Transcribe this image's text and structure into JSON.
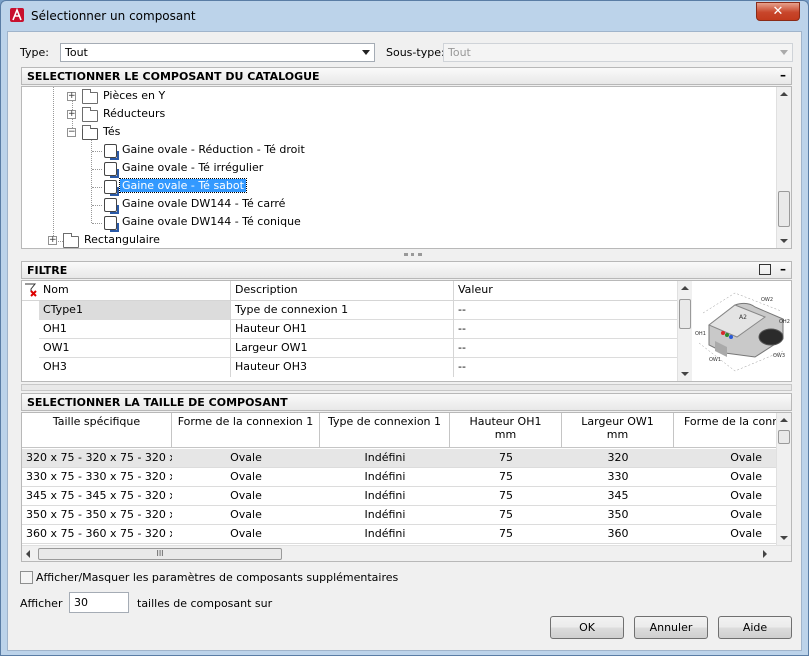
{
  "window": {
    "title": "Sélectionner un composant",
    "close": "✕"
  },
  "type_row": {
    "type_label": "Type:",
    "type_value": "Tout",
    "subtype_label": "Sous-type:",
    "subtype_value": "Tout"
  },
  "catalog": {
    "header": "SELECTIONNER LE COMPOSANT DU CATALOGUE",
    "collapse": "–",
    "items": [
      {
        "label": "Pièces en Y"
      },
      {
        "label": "Réducteurs"
      },
      {
        "label": "Tés"
      },
      {
        "label": "Gaine ovale - Réduction - Té droit"
      },
      {
        "label": "Gaine ovale - Té irrégulier"
      },
      {
        "label": "Gaine ovale - Té sabot"
      },
      {
        "label": "Gaine ovale DW144 - Té carré"
      },
      {
        "label": "Gaine ovale DW144 - Té conique"
      },
      {
        "label": "Rectangulaire"
      }
    ]
  },
  "filter": {
    "header": "FILTRE",
    "collapse": "–",
    "columns": [
      "Nom",
      "Description",
      "Valeur"
    ],
    "rows": [
      {
        "name": "CType1",
        "desc": "Type de connexion 1",
        "value": "--"
      },
      {
        "name": "OH1",
        "desc": "Hauteur OH1",
        "value": "--"
      },
      {
        "name": "OW1",
        "desc": "Largeur OW1",
        "value": "--"
      },
      {
        "name": "OH3",
        "desc": "Hauteur OH3",
        "value": "--"
      }
    ],
    "preview_labels": {
      "ow2": "OW2",
      "a2": "A2",
      "oh2": "OH2",
      "oh1": "OH1",
      "ow1": "OW1",
      "ow3": "OW3"
    }
  },
  "size": {
    "header": "SELECTIONNER LA TAILLE DE COMPOSANT",
    "columns": [
      {
        "l1": "Taille spécifique",
        "l2": ""
      },
      {
        "l1": "Forme de la connexion 1",
        "l2": ""
      },
      {
        "l1": "Type de connexion 1",
        "l2": ""
      },
      {
        "l1": "Hauteur OH1",
        "l2": "mm"
      },
      {
        "l1": "Largeur OW1",
        "l2": "mm"
      },
      {
        "l1": "Forme de la conn",
        "l2": ""
      }
    ],
    "rows": [
      {
        "size": "320 x 75 - 320 x 75 - 320 x ...",
        "shape": "Ovale",
        "type": "Indéfini",
        "oh1": "75",
        "ow1": "320",
        "shape2": "Ovale"
      },
      {
        "size": "330 x 75 - 330 x 75 - 320 x ...",
        "shape": "Ovale",
        "type": "Indéfini",
        "oh1": "75",
        "ow1": "330",
        "shape2": "Ovale"
      },
      {
        "size": "345 x 75 - 345 x 75 - 320 x ...",
        "shape": "Ovale",
        "type": "Indéfini",
        "oh1": "75",
        "ow1": "345",
        "shape2": "Ovale"
      },
      {
        "size": "350 x 75 - 350 x 75 - 320 x ...",
        "shape": "Ovale",
        "type": "Indéfini",
        "oh1": "75",
        "ow1": "350",
        "shape2": "Ovale"
      },
      {
        "size": "360 x 75 - 360 x 75 - 320 x ...",
        "shape": "Ovale",
        "type": "Indéfini",
        "oh1": "75",
        "ow1": "360",
        "shape2": "Ovale"
      }
    ],
    "hscroll_grip": "III"
  },
  "options": {
    "show_params_label": "Afficher/Masquer les paramètres de composants supplémentaires",
    "afficher_label": "Afficher",
    "afficher_value": "30",
    "afficher_suffix": "tailles de composant sur"
  },
  "buttons": {
    "ok": "OK",
    "cancel": "Annuler",
    "help": "Aide"
  },
  "colors": {
    "selection": "#3399ff",
    "title_bg": "#bcd3ea",
    "close_red": "#c8462b"
  }
}
